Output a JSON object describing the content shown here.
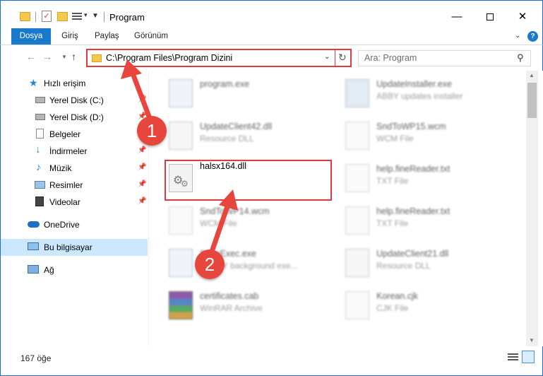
{
  "window": {
    "title": "Program",
    "controls": {
      "minimize": "—",
      "maximize": "",
      "close": "✕"
    }
  },
  "ribbon": {
    "tabs": [
      "Dosya",
      "Giriş",
      "Paylaş",
      "Görünüm"
    ],
    "help": "?"
  },
  "address": {
    "path": "C:\\Program Files\\Program Dizini",
    "search_placeholder": "Ara: Program"
  },
  "sidebar": {
    "items": [
      {
        "label": "Hızlı erişim",
        "icon": "star-icon",
        "pinned": false
      },
      {
        "label": "Yerel Disk (C:)",
        "icon": "drive-icon",
        "pinned": true
      },
      {
        "label": "Yerel Disk (D:)",
        "icon": "drive-icon",
        "pinned": true
      },
      {
        "label": "Belgeler",
        "icon": "document-icon",
        "pinned": true
      },
      {
        "label": "İndirmeler",
        "icon": "download-icon",
        "pinned": true
      },
      {
        "label": "Müzik",
        "icon": "music-icon",
        "pinned": true
      },
      {
        "label": "Resimler",
        "icon": "pictures-icon",
        "pinned": true
      },
      {
        "label": "Videolar",
        "icon": "video-icon",
        "pinned": true
      },
      {
        "label": "OneDrive",
        "icon": "cloud-icon",
        "pinned": false
      },
      {
        "label": "Bu bilgisayar",
        "icon": "computer-icon",
        "pinned": false
      },
      {
        "label": "Ağ",
        "icon": "network-icon",
        "pinned": false
      }
    ]
  },
  "files": [
    {
      "name": "program.exe",
      "type": "",
      "icon": "exe-icon"
    },
    {
      "name": "UpdateInstaller.exe",
      "type": "ABBY updates installer",
      "icon": "exe-icon"
    },
    {
      "name": "UpdateClient42.dll",
      "type": "Resource DLL",
      "icon": "dll-icon"
    },
    {
      "name": "SndToWP15.wcm",
      "type": "WCM File",
      "icon": "document-icon"
    },
    {
      "name": "halsx164.dll",
      "type": "",
      "icon": "dll-gear-icon"
    },
    {
      "name": "help.fineReader.txt",
      "type": "TXT File",
      "icon": "document-icon"
    },
    {
      "name": "SndToWP14.wcm",
      "type": "WCM File",
      "icon": "document-icon"
    },
    {
      "name": "help.fineReader.txt",
      "type": "TXT File",
      "icon": "document-icon"
    },
    {
      "name": "ScanExec.exe",
      "type": "ABBYY background exe...",
      "icon": "exe-icon"
    },
    {
      "name": "UpdateClient21.dll",
      "type": "Resource DLL",
      "icon": "dll-icon"
    },
    {
      "name": "certificates.cab",
      "type": "WinRAR Archive",
      "icon": "archive-icon"
    },
    {
      "name": "Korean.cjk",
      "type": "CJK File",
      "icon": "document-icon"
    }
  ],
  "status": {
    "count": "167 öğe"
  },
  "annotations": {
    "step1": "1",
    "step2": "2"
  },
  "colors": {
    "accent": "#1979ca",
    "highlight": "#e0393e",
    "badge": "#e8453c"
  }
}
